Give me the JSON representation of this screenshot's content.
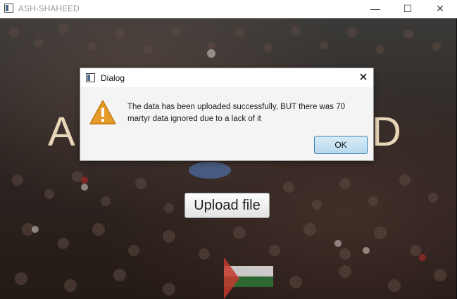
{
  "window": {
    "title": "ASH-SHAHEED",
    "controls": {
      "minimize": "—",
      "maximize": "☐",
      "close": "✕"
    }
  },
  "background": {
    "heading_left": "A",
    "heading_right": "D",
    "upload_button": "Upload file"
  },
  "dialog": {
    "title": "Dialog",
    "close": "✕",
    "icon": "warning-icon",
    "message": "The data has been uploaded successfully, BUT there was 70 martyr data ignored due to a lack of it",
    "ok_label": "OK"
  },
  "colors": {
    "heading": "#f1dfbf",
    "ok_button": "#b7d9ee",
    "warning": "#e49b2a"
  }
}
